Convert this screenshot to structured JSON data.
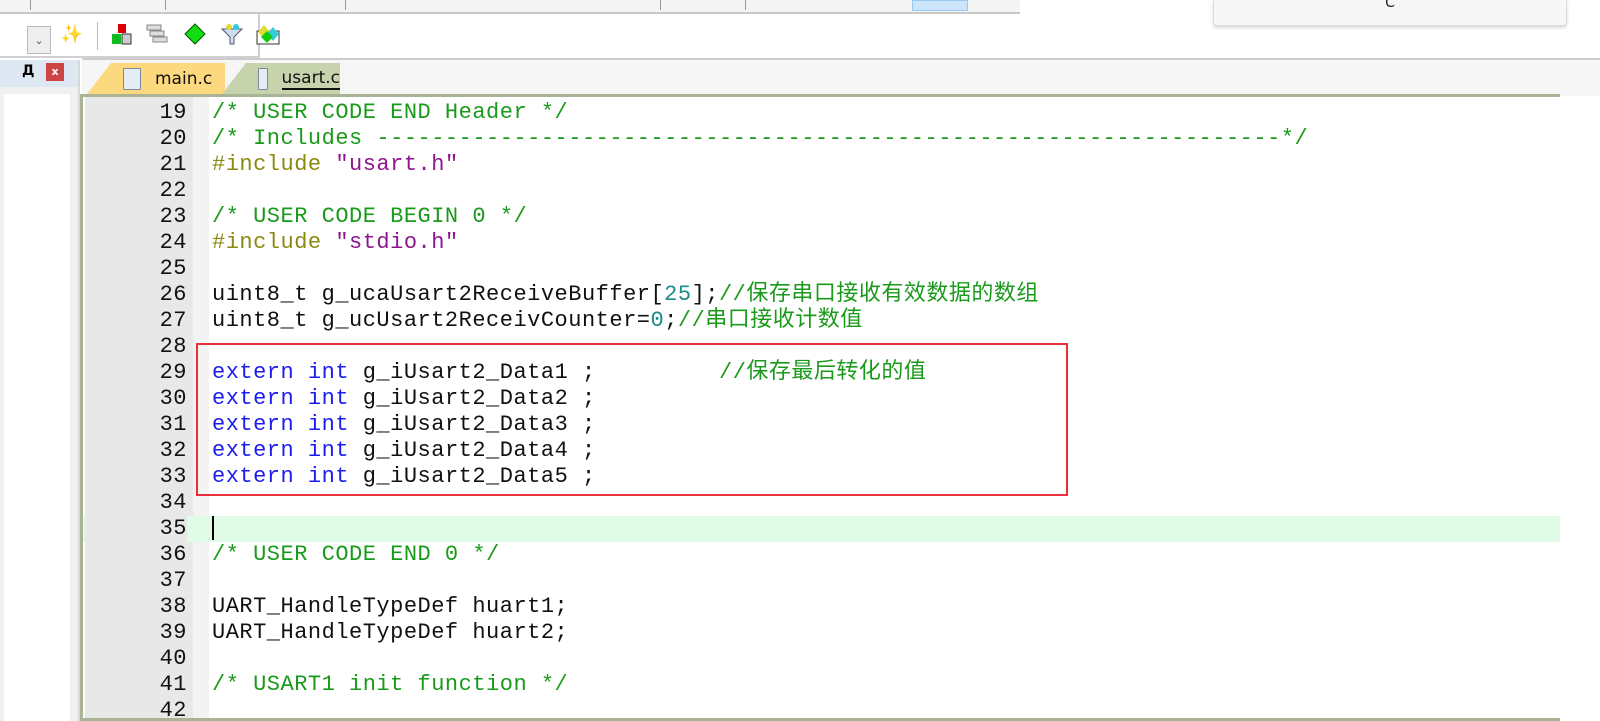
{
  "popup": {
    "text": "C"
  },
  "toolbar2": {
    "icons": [
      "dropdown-icon",
      "configure-wizard-icon",
      "manage-components-icon",
      "select-packs-icon",
      "pack-installer-icon",
      "filter-icon",
      "event-recorder-icon"
    ]
  },
  "left_panel": {
    "pin_label": "Д",
    "close_label": "x"
  },
  "tabs": [
    {
      "label": "main.c",
      "color": "#fcd97f",
      "active": false
    },
    {
      "label": "usart.c",
      "color": "#c6d3ad",
      "active": true
    }
  ],
  "colors": {
    "comment": "#1a9a1a",
    "keyword": "#1c1cf0",
    "preprocessor": "#8a8a10",
    "string": "#8e168e",
    "number": "#1a8a8a",
    "current_line": "#e0fce6",
    "highlight_box": "#e8303a"
  },
  "editor": {
    "current_line": 35,
    "highlight_box_lines": [
      29,
      33
    ],
    "lines": [
      {
        "n": "19",
        "tokens": [
          {
            "t": "/* USER CODE END Header */",
            "c": "comment"
          }
        ]
      },
      {
        "n": "20",
        "tokens": [
          {
            "t": "/* Includes ------------------------------------------------------------------*/",
            "c": "comment"
          }
        ]
      },
      {
        "n": "21",
        "tokens": [
          {
            "t": "#include ",
            "c": "pp"
          },
          {
            "t": "\"usart.h\"",
            "c": "str"
          }
        ]
      },
      {
        "n": "22",
        "tokens": []
      },
      {
        "n": "23",
        "tokens": [
          {
            "t": "/* USER CODE BEGIN 0 */",
            "c": "comment"
          }
        ]
      },
      {
        "n": "24",
        "tokens": [
          {
            "t": "#include ",
            "c": "pp"
          },
          {
            "t": "\"stdio.h\"",
            "c": "str"
          }
        ]
      },
      {
        "n": "25",
        "tokens": []
      },
      {
        "n": "26",
        "tokens": [
          {
            "t": "uint8_t g_ucaUsart2ReceiveBuffer[",
            "c": "plain"
          },
          {
            "t": "25",
            "c": "num"
          },
          {
            "t": "];",
            "c": "plain"
          },
          {
            "t": "//保存串口接收有效数据的数组",
            "c": "comment"
          }
        ]
      },
      {
        "n": "27",
        "tokens": [
          {
            "t": "uint8_t g_ucUsart2ReceivCounter=",
            "c": "plain"
          },
          {
            "t": "0",
            "c": "num"
          },
          {
            "t": ";",
            "c": "plain"
          },
          {
            "t": "//串口接收计数值",
            "c": "comment"
          }
        ]
      },
      {
        "n": "28",
        "tokens": []
      },
      {
        "n": "29",
        "tokens": [
          {
            "t": "extern",
            "c": "kw"
          },
          {
            "t": " ",
            "c": "plain"
          },
          {
            "t": "int",
            "c": "kw"
          },
          {
            "t": " g_iUsart2_Data1 ;         ",
            "c": "plain"
          },
          {
            "t": "//保存最后转化的值",
            "c": "comment"
          }
        ]
      },
      {
        "n": "30",
        "tokens": [
          {
            "t": "extern",
            "c": "kw"
          },
          {
            "t": " ",
            "c": "plain"
          },
          {
            "t": "int",
            "c": "kw"
          },
          {
            "t": " g_iUsart2_Data2 ;",
            "c": "plain"
          }
        ]
      },
      {
        "n": "31",
        "tokens": [
          {
            "t": "extern",
            "c": "kw"
          },
          {
            "t": " ",
            "c": "plain"
          },
          {
            "t": "int",
            "c": "kw"
          },
          {
            "t": " g_iUsart2_Data3 ;",
            "c": "plain"
          }
        ]
      },
      {
        "n": "32",
        "tokens": [
          {
            "t": "extern",
            "c": "kw"
          },
          {
            "t": " ",
            "c": "plain"
          },
          {
            "t": "int",
            "c": "kw"
          },
          {
            "t": " g_iUsart2_Data4 ;",
            "c": "plain"
          }
        ]
      },
      {
        "n": "33",
        "tokens": [
          {
            "t": "extern",
            "c": "kw"
          },
          {
            "t": " ",
            "c": "plain"
          },
          {
            "t": "int",
            "c": "kw"
          },
          {
            "t": " g_iUsart2_Data5 ;",
            "c": "plain"
          }
        ]
      },
      {
        "n": "34",
        "tokens": []
      },
      {
        "n": "35",
        "tokens": []
      },
      {
        "n": "36",
        "tokens": [
          {
            "t": "/* USER CODE END 0 */",
            "c": "comment"
          }
        ]
      },
      {
        "n": "37",
        "tokens": []
      },
      {
        "n": "38",
        "tokens": [
          {
            "t": "UART_HandleTypeDef huart1;",
            "c": "plain"
          }
        ]
      },
      {
        "n": "39",
        "tokens": [
          {
            "t": "UART_HandleTypeDef huart2;",
            "c": "plain"
          }
        ]
      },
      {
        "n": "40",
        "tokens": []
      },
      {
        "n": "41",
        "tokens": [
          {
            "t": "/* USART1 init function */",
            "c": "comment"
          }
        ]
      },
      {
        "n": "42",
        "tokens": []
      }
    ]
  }
}
